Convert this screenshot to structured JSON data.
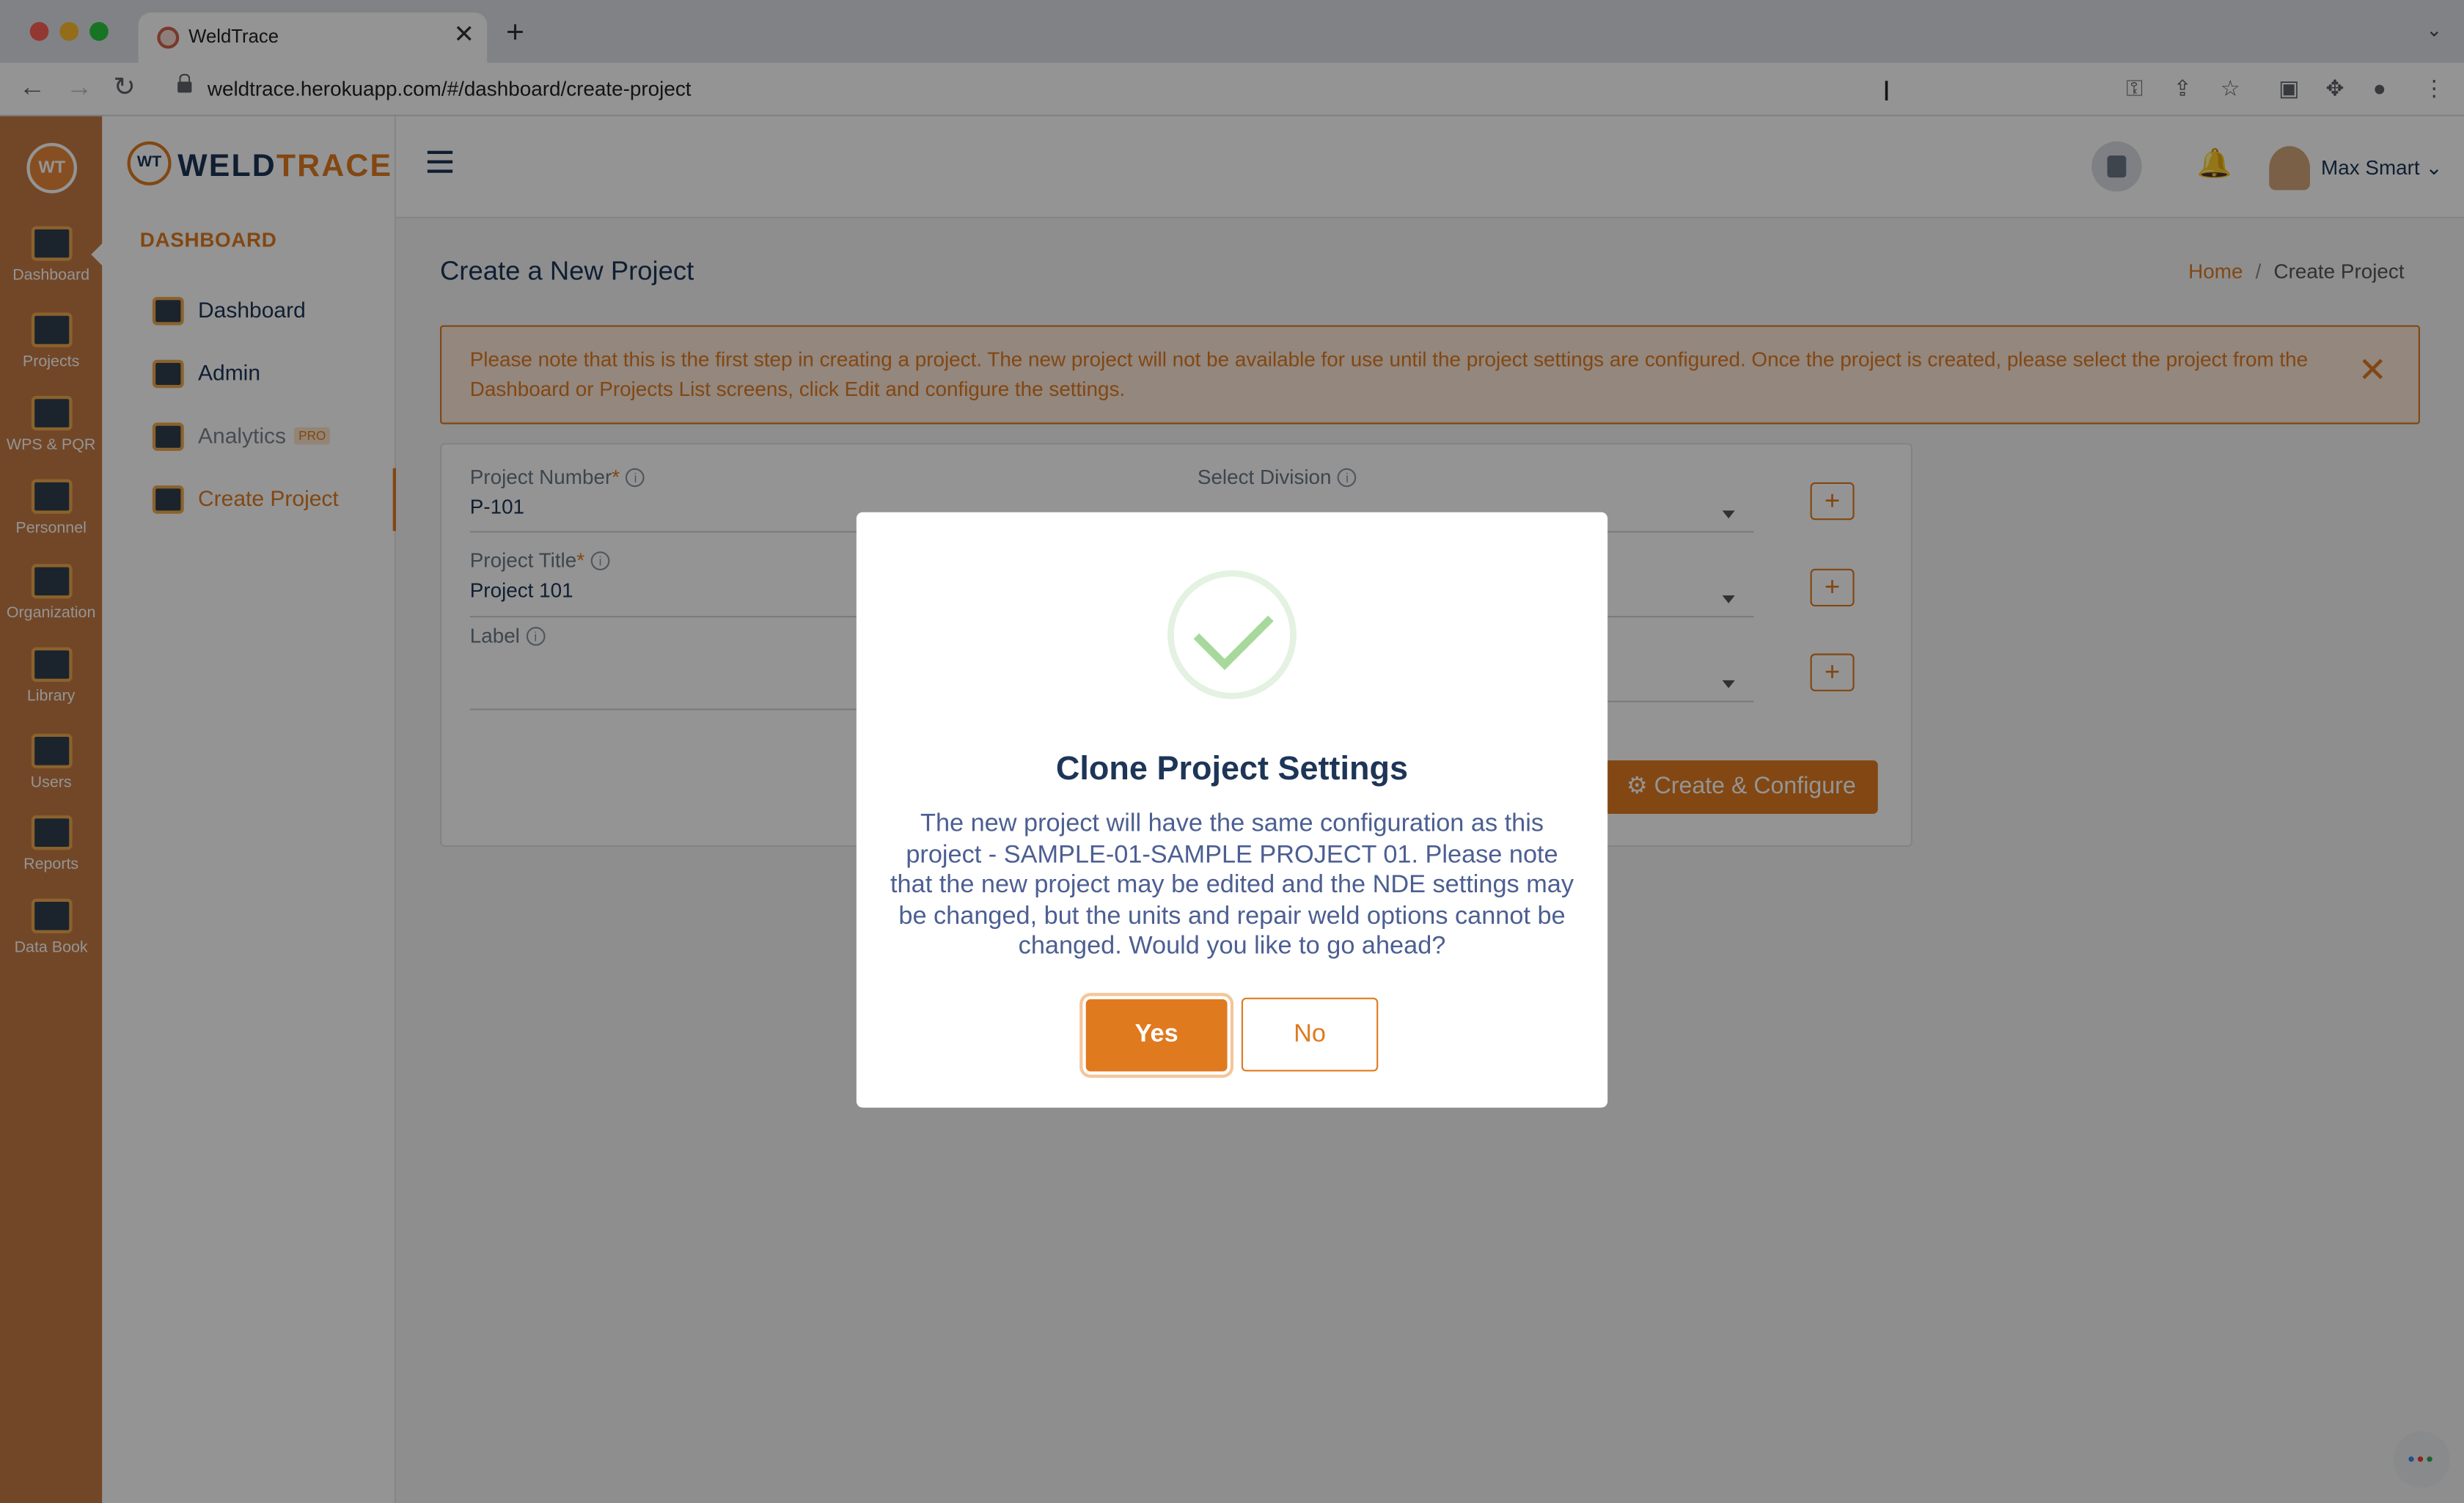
{
  "browser": {
    "tab_title": "WeldTrace",
    "url": "weldtrace.herokuapp.com/#/dashboard/create-project",
    "new_tab_glyph": "+",
    "close_glyph": "✕",
    "tab_menu_glyph": "⌄"
  },
  "rail": {
    "logo_text": "WT",
    "items": [
      {
        "label": "Dashboard",
        "icon": "monitor-icon"
      },
      {
        "label": "Projects",
        "icon": "folder-icon"
      },
      {
        "label": "WPS & PQR",
        "icon": "document-gear-icon"
      },
      {
        "label": "Personnel",
        "icon": "welder-icon"
      },
      {
        "label": "Organization",
        "icon": "org-chart-icon"
      },
      {
        "label": "Library",
        "icon": "library-icon"
      },
      {
        "label": "Users",
        "icon": "users-icon"
      },
      {
        "label": "Reports",
        "icon": "report-icon"
      },
      {
        "label": "Data Book",
        "icon": "data-book-icon"
      }
    ]
  },
  "sidebar": {
    "brand_weld": "WELD",
    "brand_trace": "TRACE",
    "brand_mark": "WT",
    "section_title": "DASHBOARD",
    "items": [
      {
        "label": "Dashboard",
        "icon": "chart-icon"
      },
      {
        "label": "Admin",
        "icon": "gear-icon"
      },
      {
        "label": "Analytics",
        "icon": "analytics-icon",
        "badge": "PRO"
      },
      {
        "label": "Create Project",
        "icon": "folder-plus-icon",
        "active": true
      }
    ]
  },
  "topbar": {
    "user_name": "Max Smart",
    "user_caret": "⌄",
    "bell_glyph": "🔔"
  },
  "page": {
    "title": "Create a New Project",
    "breadcrumb": {
      "home": "Home",
      "separator": "/",
      "current": "Create Project"
    },
    "notice": "Please note that this is the first step in creating a project. The new project will not be available for use until the project settings are configured. Once the project is created, please select the project from the Dashboard or Projects List screens, click Edit and configure the settings.",
    "notice_close": "✕"
  },
  "form": {
    "project_number": {
      "label": "Project Number",
      "required_mark": "*",
      "value": "P-101"
    },
    "project_title": {
      "label": "Project Title",
      "required_mark": "*",
      "value": "Project 101"
    },
    "label": {
      "label": "Label",
      "value": ""
    },
    "division": {
      "label": "Select Division",
      "value": ""
    },
    "info_glyph": "i",
    "plus_glyph": "+",
    "submit_label": "⚙ Create & Configure"
  },
  "modal": {
    "title": "Clone Project Settings",
    "body": "The new project will have the same configuration as this project - SAMPLE-01-SAMPLE PROJECT 01. Please note that the new project may be edited and the NDE settings may be changed, but the units and repair weld options cannot be changed. Would you like to go ahead?",
    "yes_label": "Yes",
    "no_label": "No"
  },
  "colors": {
    "accent": "#e07a1f",
    "rail": "#c57a44",
    "navy": "#1d3557",
    "success": "#a6d99b"
  }
}
